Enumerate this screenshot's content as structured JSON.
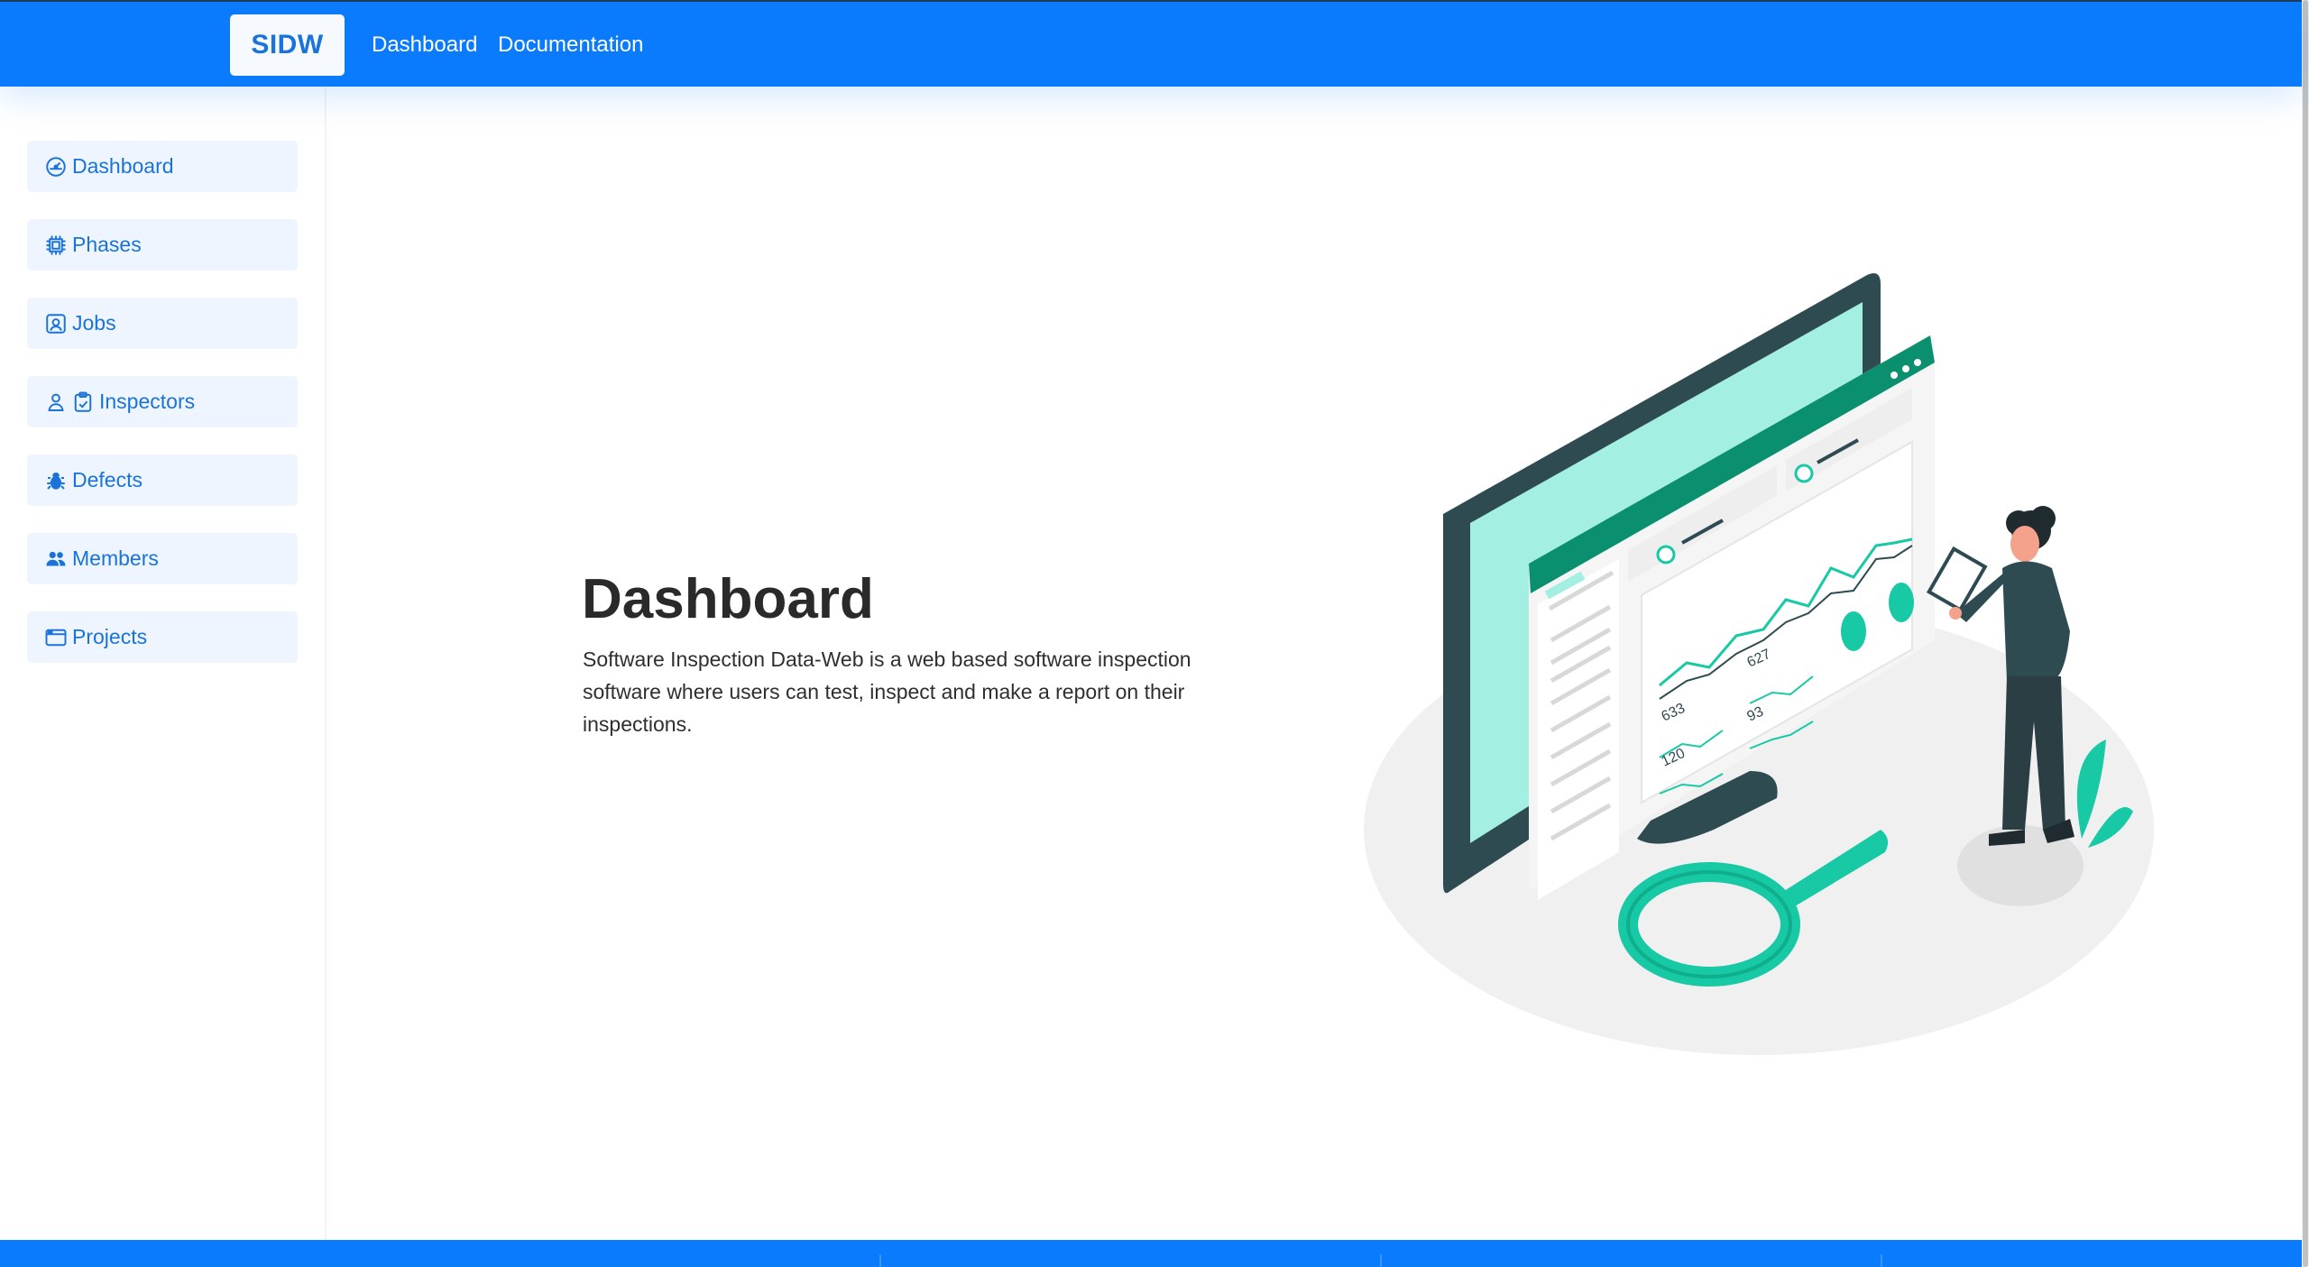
{
  "header": {
    "brand": "SIDW",
    "nav": [
      {
        "label": "Dashboard"
      },
      {
        "label": "Documentation"
      }
    ]
  },
  "sidebar": {
    "items": [
      {
        "label": "Dashboard",
        "icon": "speedometer-icon"
      },
      {
        "label": "Phases",
        "icon": "cpu-icon"
      },
      {
        "label": "Jobs",
        "icon": "person-badge-icon"
      },
      {
        "label": "Inspectors",
        "icon": "person-icon,clipboard-check-icon"
      },
      {
        "label": "Defects",
        "icon": "bug-icon"
      },
      {
        "label": "Members",
        "icon": "people-icon"
      },
      {
        "label": "Projects",
        "icon": "window-icon"
      }
    ]
  },
  "main": {
    "title": "Dashboard",
    "description": "Software Inspection Data-Web is a web based software inspection software where users can test, inspect and make a report on their inspections.",
    "illustration": {
      "chart_labels": [
        "633",
        "627",
        "93",
        "120"
      ]
    }
  },
  "colors": {
    "primary": "#0a7bfc",
    "accent": "#1a73d9",
    "sidebar_item_bg": "#eef5fe",
    "illustration_teal": "#17c9a5",
    "illustration_dark": "#2f4b52"
  }
}
